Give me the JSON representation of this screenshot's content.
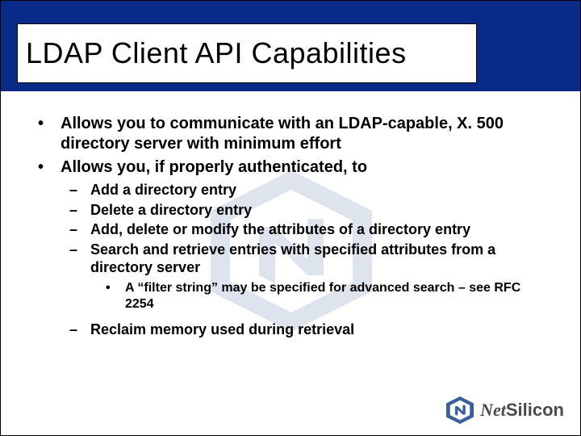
{
  "title": "LDAP Client API Capabilities",
  "bullets": {
    "b1": "Allows you to communicate with an LDAP-capable, X. 500 directory server with minimum effort",
    "b2": "Allows you, if properly authenticated, to",
    "b2_sub": {
      "s1": "Add a directory entry",
      "s2": "Delete a directory entry",
      "s3": "Add, delete or modify the attributes of a directory entry",
      "s4": "Search and retrieve entries with specified attributes from a directory server",
      "s4_sub1": "A “filter string” may be specified for advanced search – see RFC 2254",
      "s5": "Reclaim memory used during retrieval"
    }
  },
  "brand": {
    "net": "Net",
    "silicon": "Silicon"
  },
  "marks": {
    "dot": "•",
    "dash": "–"
  }
}
